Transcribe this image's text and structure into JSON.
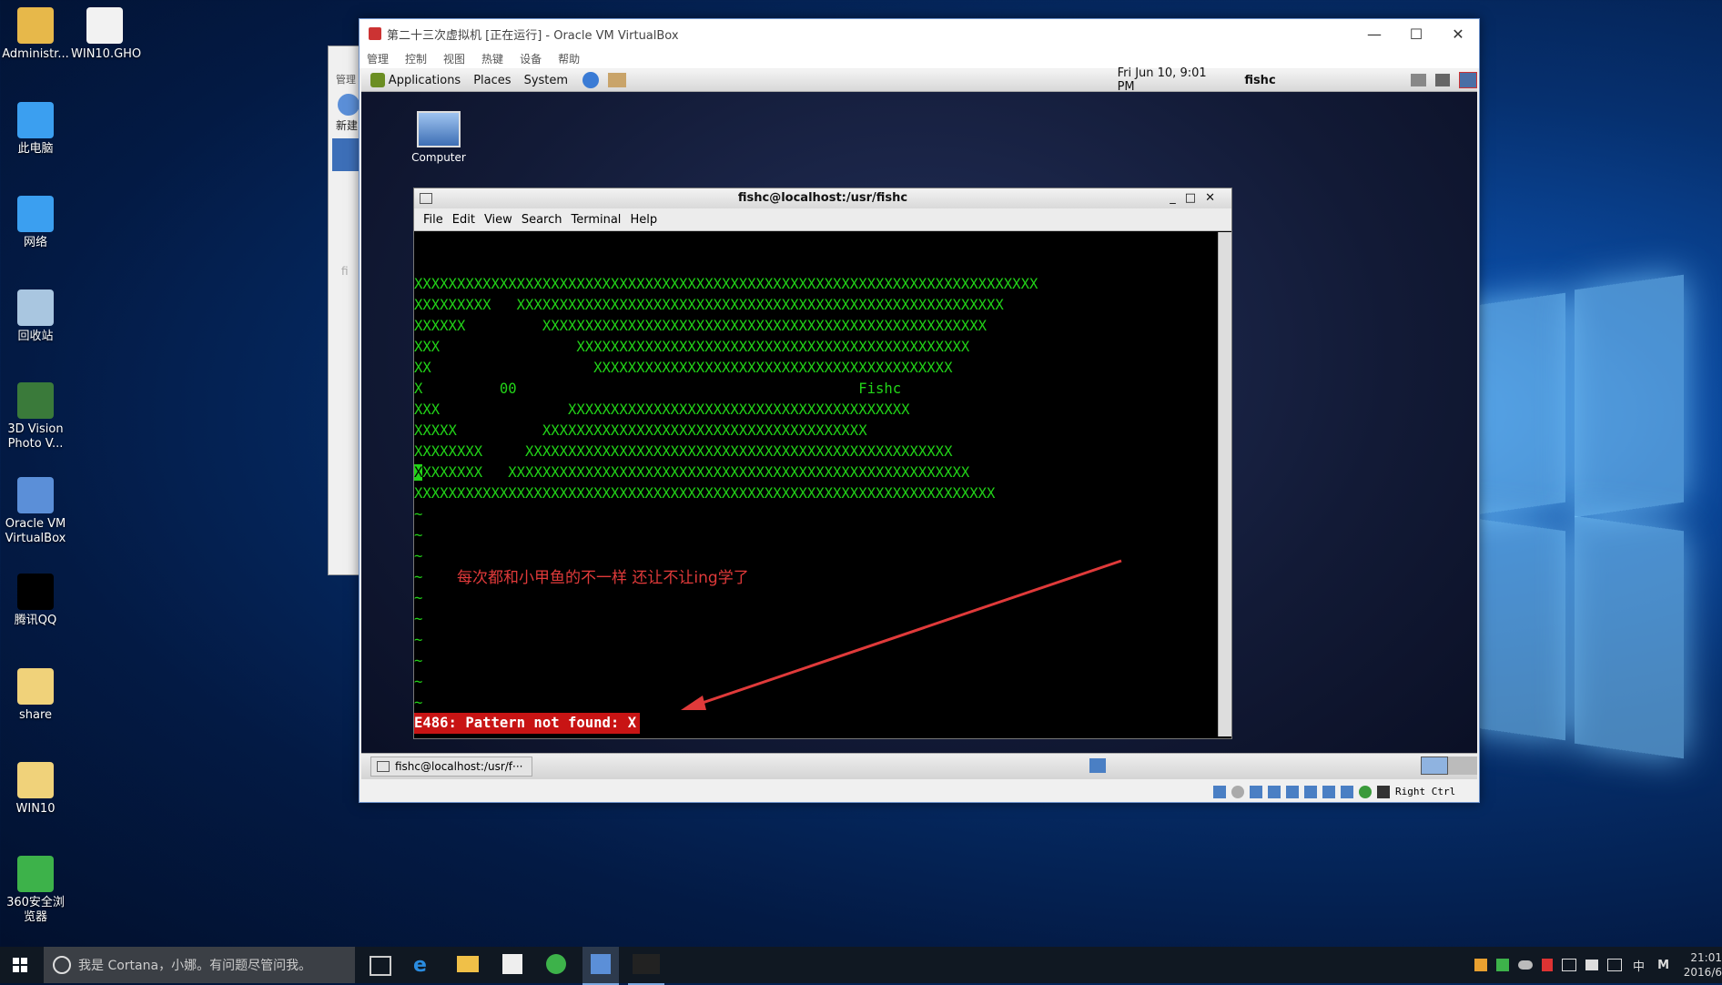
{
  "desktop": {
    "icons": [
      {
        "label": "Administr...",
        "color": "#e7b84a"
      },
      {
        "label": "WIN10.GHO",
        "color": "#f2f2f2"
      },
      {
        "label": "此电脑",
        "color": "#3b9ff0"
      },
      {
        "label": "网络",
        "color": "#3b9ff0"
      },
      {
        "label": "回收站",
        "color": "#a9c6e0"
      },
      {
        "label": "3D Vision Photo V...",
        "color": "#3a7a3a"
      },
      {
        "label": "Oracle VM VirtualBox",
        "color": "#5b8fd8"
      },
      {
        "label": "腾讯QQ",
        "color": "#000000"
      },
      {
        "label": "share",
        "color": "#f0d27a"
      },
      {
        "label": "WIN10",
        "color": "#f0d27a"
      },
      {
        "label": "360安全浏览器",
        "color": "#3db24a"
      }
    ]
  },
  "manager_window": {
    "menu_label": "管理",
    "new_label": "新建",
    "fragment": "fi"
  },
  "vm_window": {
    "title": "第二十三次虚拟机 [正在运行] - Oracle VM VirtualBox",
    "menu": [
      "管理",
      "控制",
      "视图",
      "热键",
      "设备",
      "帮助"
    ],
    "host_key": "Right Ctrl"
  },
  "guest": {
    "panel": {
      "apps": "Applications",
      "places": "Places",
      "system": "System",
      "datetime": "Fri Jun 10,  9:01 PM",
      "user": "fishc"
    },
    "desktop_icon": "Computer",
    "taskbar_button": "fishc@localhost:/usr/f···"
  },
  "terminal": {
    "title": "fishc@localhost:/usr/fishc",
    "menu": [
      "File",
      "Edit",
      "View",
      "Search",
      "Terminal",
      "Help"
    ],
    "lines": [
      "XXXXXXXXXXXXXXXXXXXXXXXXXXXXXXXXXXXXXXXXXXXXXXXXXXXXXXXXXXXXXXXXXXXXXXXXX",
      "XXXXXXXXX   XXXXXXXXXXXXXXXXXXXXXXXXXXXXXXXXXXXXXXXXXXXXXXXXXXXXXXXXX",
      "XXXXXX         XXXXXXXXXXXXXXXXXXXXXXXXXXXXXXXXXXXXXXXXXXXXXXXXXXXX",
      "XXX                XXXXXXXXXXXXXXXXXXXXXXXXXXXXXXXXXXXXXXXXXXXXXX",
      "XX                   XXXXXXXXXXXXXXXXXXXXXXXXXXXXXXXXXXXXXXXXXX",
      "X         00                                        Fishc",
      "XXX               XXXXXXXXXXXXXXXXXXXXXXXXXXXXXXXXXXXXXXXX",
      "XXXXX          XXXXXXXXXXXXXXXXXXXXXXXXXXXXXXXXXXXXXX",
      "XXXXXXXX     XXXXXXXXXXXXXXXXXXXXXXXXXXXXXXXXXXXXXXXXXXXXXXXXXX",
      "XXXXXXXX   XXXXXXXXXXXXXXXXXXXXXXXXXXXXXXXXXXXXXXXXXXXXXXXXXXXXXX",
      "XXXXXXXXXXXXXXXXXXXXXXXXXXXXXXXXXXXXXXXXXXXXXXXXXXXXXXXXXXXXXXXXXXXX",
      "~",
      "~",
      "~",
      "~",
      "~",
      "~",
      "~",
      "~",
      "~",
      "~",
      "~",
      "~"
    ],
    "cursor_char": "X",
    "cursor_rest": "XXXXXXX   XXXXXXXXXXXXXXXXXXXXXXXXXXXXXXXXXXXXXXXXXXXXXXXXXXXXXX",
    "error": "E486: Pattern not found: X"
  },
  "annotation": {
    "text": "每次都和小甲鱼的不一样 还让不让ing学了",
    "color": "#e03a3a"
  },
  "taskbar": {
    "search_placeholder": "我是 Cortana，小娜。有问题尽管问我。",
    "ime": "中",
    "ime2": "M",
    "time": "21:01",
    "date": "2016/6"
  }
}
